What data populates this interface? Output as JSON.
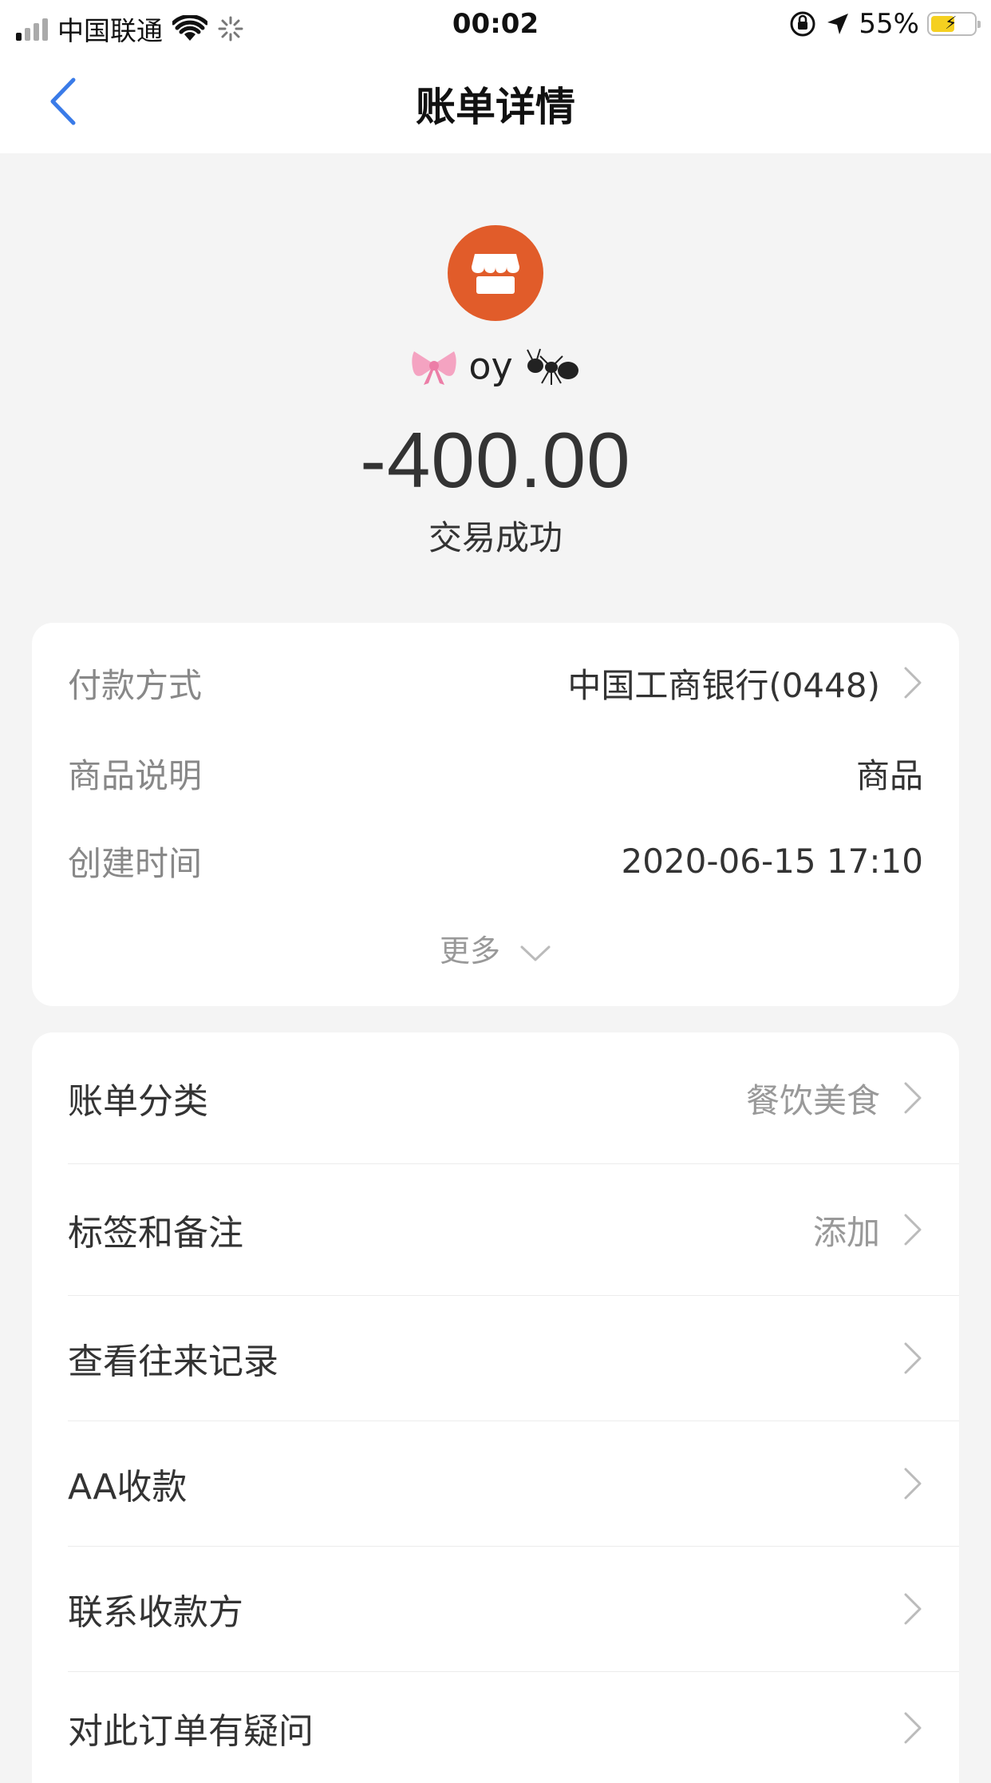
{
  "status_bar": {
    "carrier": "中国联通",
    "time": "00:02",
    "battery_percent": "55%",
    "battery_level": 0.55,
    "icons": [
      "signal-icon",
      "wifi-icon",
      "loading-icon",
      "orientation-lock-icon",
      "location-icon",
      "battery-icon"
    ]
  },
  "nav": {
    "title": "账单详情",
    "back_icon": "chevron-left-icon"
  },
  "header": {
    "merchant_icon": "store-icon",
    "merchant_name": "oy",
    "merchant_emoji_left": "bow-emoji",
    "merchant_emoji_right": "ant-emoji",
    "amount": "-400.00",
    "status": "交易成功"
  },
  "info": {
    "rows": [
      {
        "label": "付款方式",
        "value": "中国工商银行(0448)"
      },
      {
        "label": "商品说明",
        "value": "商品"
      },
      {
        "label": "创建时间",
        "value": "2020-06-15 17:10"
      }
    ],
    "more_label": "更多"
  },
  "actions": [
    {
      "label": "账单分类",
      "value": "餐饮美食"
    },
    {
      "label": "标签和备注",
      "value": "添加"
    },
    {
      "label": "查看往来记录",
      "value": ""
    },
    {
      "label": "AA收款",
      "value": ""
    },
    {
      "label": "联系收款方",
      "value": ""
    },
    {
      "label": "对此订单有疑问",
      "value": ""
    }
  ],
  "colors": {
    "accent_blue": "#3a7be8",
    "merchant_orange": "#e15c2a",
    "battery_yellow": "#f5d020",
    "background": "#f4f4f4"
  }
}
